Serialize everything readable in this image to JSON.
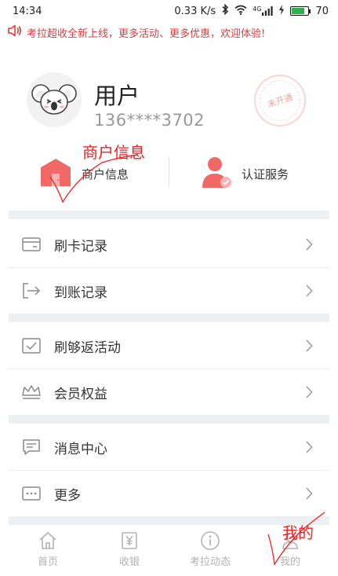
{
  "status_bar": {
    "time": "14:34",
    "network_speed": "0.33 K/s",
    "network_type": "4G",
    "battery": "70",
    "battery_level": 0.7
  },
  "notice": {
    "text": "考拉超收全新上线，更多活动、更多优惠，欢迎体验!",
    "icon": "speaker-icon"
  },
  "profile": {
    "name": "用户",
    "phone": "136****3702",
    "stamp": "未开通"
  },
  "services": {
    "merchant": {
      "label": "商户信息",
      "icon": "merchant-store-icon"
    },
    "auth": {
      "label": "认证服务",
      "icon": "verified-user-icon"
    }
  },
  "menu": {
    "card_records": {
      "label": "刷卡记录",
      "icon": "card-icon"
    },
    "arrival_records": {
      "label": "到账记录",
      "icon": "transfer-in-icon"
    },
    "cashback_activity": {
      "label": "刷够返活动",
      "icon": "check-box-icon"
    },
    "member_benefits": {
      "label": "会员权益",
      "icon": "crown-icon"
    },
    "message_center": {
      "label": "消息中心",
      "icon": "message-icon"
    },
    "more": {
      "label": "更多",
      "icon": "more-dots-icon"
    }
  },
  "tabbar": {
    "home": {
      "label": "首页",
      "icon": "home-icon"
    },
    "cashier": {
      "label": "收银",
      "icon": "yuan-receipt-icon"
    },
    "news": {
      "label": "考拉动态",
      "icon": "info-icon"
    },
    "mine": {
      "label": "我的",
      "icon": "person-icon"
    }
  },
  "annotations": {
    "merchant_info": "商户信息",
    "mine": "我的"
  },
  "colors": {
    "accent_red": "#e5393e",
    "icon_red": "#f06966",
    "band_gray": "#edf0f3",
    "text_gray": "#999999",
    "annotation_red": "#ff1a1a"
  }
}
